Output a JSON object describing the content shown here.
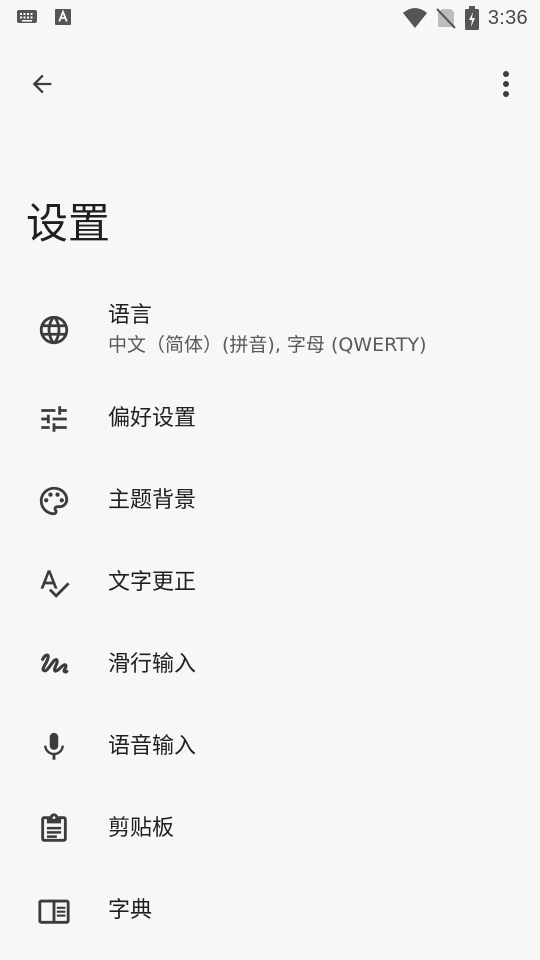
{
  "status_bar": {
    "time": "3:36",
    "left_icons": [
      "keyboard-icon",
      "text-a-icon"
    ],
    "right_icons": [
      "wifi-icon",
      "no-sim-icon",
      "battery-charging-icon"
    ]
  },
  "app_bar": {
    "back_icon": "arrow-back-icon",
    "menu_icon": "more-vertical-icon"
  },
  "page": {
    "title": "设置"
  },
  "settings": {
    "items": [
      {
        "icon": "globe-icon",
        "title": "语言",
        "subtitle": "中文（简体）(拼音), 字母 (QWERTY)"
      },
      {
        "icon": "tune-sliders-icon",
        "title": "偏好设置"
      },
      {
        "icon": "palette-icon",
        "title": "主题背景"
      },
      {
        "icon": "spellcheck-icon",
        "title": "文字更正"
      },
      {
        "icon": "gesture-icon",
        "title": "滑行输入"
      },
      {
        "icon": "microphone-icon",
        "title": "语音输入"
      },
      {
        "icon": "clipboard-icon",
        "title": "剪贴板"
      },
      {
        "icon": "dictionary-book-icon",
        "title": "字典"
      }
    ]
  },
  "colors": {
    "background": "#f7f7f7",
    "text_primary": "#1f1f1f",
    "text_secondary": "#5a5a5a",
    "icon": "#3c3c3c",
    "status_icon": "#555555"
  }
}
